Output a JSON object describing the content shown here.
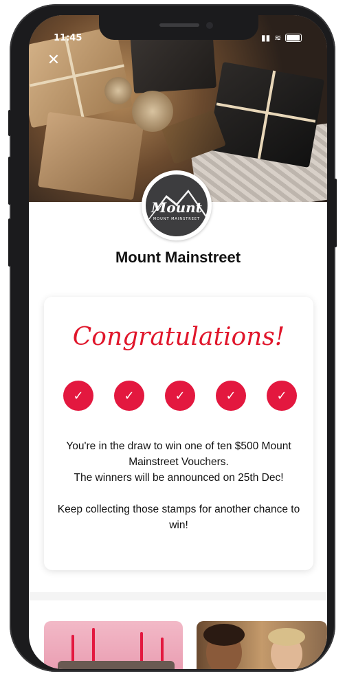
{
  "status_bar": {
    "time": "11:45"
  },
  "merchant": {
    "name": "Mount Mainstreet"
  },
  "logo": {
    "text": "Mount",
    "subtext": "MOUNT MAINSTREET"
  },
  "card": {
    "heading": "Congratulations!",
    "stamps_collected": 5,
    "stamps_total": 5,
    "message_line1": "You're in the draw to win one of ten $500 Mount Mainstreet Vouchers.",
    "message_line2": "The winners will be announced on 25th Dec!",
    "message_line3": "Keep collecting those stamps for another chance to win!"
  },
  "icons": {
    "close": "close-icon",
    "stamp": "check-icon",
    "signal": "signal-icon",
    "wifi": "wifi-icon",
    "battery": "battery-icon"
  },
  "colors": {
    "accent": "#e3183f",
    "heading": "#e0162b"
  }
}
